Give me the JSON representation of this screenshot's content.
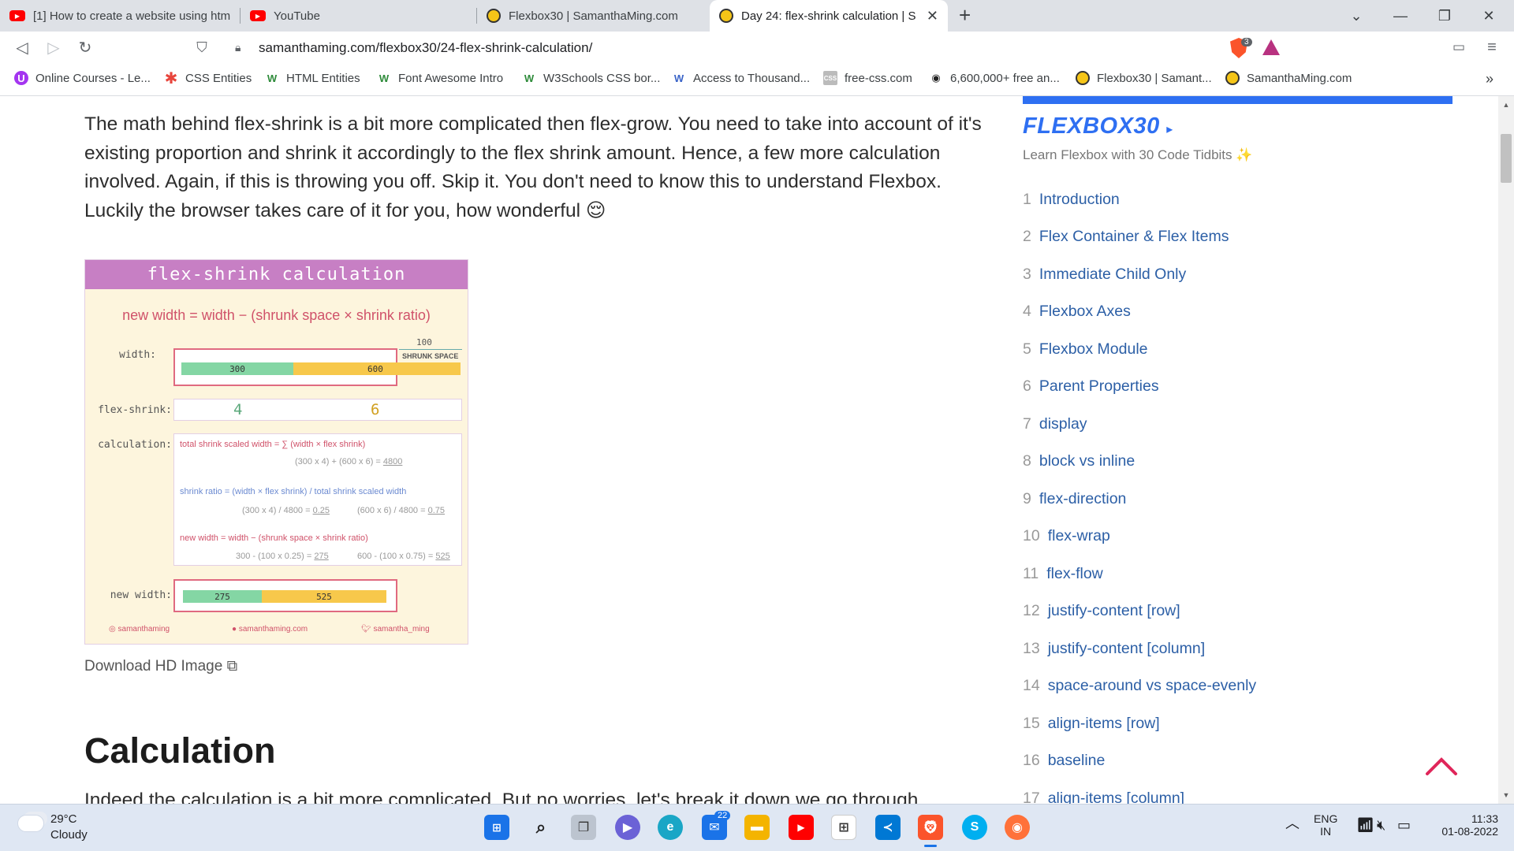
{
  "browser": {
    "tabs": [
      {
        "title": "[1] How to create a website using htm",
        "icon": "youtube-icon"
      },
      {
        "title": "YouTube",
        "icon": "youtube-icon"
      },
      {
        "title": "Flexbox30 | SamanthaMing.com",
        "icon": "samantha-icon"
      },
      {
        "title": "Day 24: flex-shrink calculation | S",
        "icon": "samantha-icon",
        "active": true
      }
    ],
    "url": "samanthaming.com/flexbox30/24-flex-shrink-calculation/",
    "shield_count": "3",
    "bookmarks": [
      {
        "label": "Online Courses - Le...",
        "icon": "udemy-icon"
      },
      {
        "label": "CSS Entities",
        "icon": "asterisk-icon"
      },
      {
        "label": "HTML Entities",
        "icon": "w-icon"
      },
      {
        "label": "Font Awesome Intro",
        "icon": "w3-icon"
      },
      {
        "label": "W3Schools CSS bor...",
        "icon": "w3-icon"
      },
      {
        "label": "Access to Thousand...",
        "icon": "w-icon"
      },
      {
        "label": "free-css.com",
        "icon": "css-icon"
      },
      {
        "label": "6,600,000+ free an...",
        "icon": "eye-icon"
      },
      {
        "label": "Flexbox30 | Samant...",
        "icon": "samantha-icon"
      },
      {
        "label": "SamanthaMing.com",
        "icon": "samantha-icon"
      }
    ]
  },
  "content": {
    "paragraph": "The math behind flex-shrink is a bit more complicated then flex-grow. You need to take into account of it's existing proportion and shrink it accordingly to the flex shrink amount. Hence, a few more calculation involved. Again, if this is throwing you off. Skip it. You don't need to know this to understand Flexbox. Luckily the browser takes care of it for you, how wonderful 😌",
    "infographic": {
      "title": "flex-shrink calculation",
      "formula": "new width  =  width  −  (shrunk space  ×  shrink ratio)",
      "width_label": "width:",
      "shrunk_value": "100",
      "shrunk_label": "SHRUNK SPACE",
      "bar_a": "300",
      "bar_b": "600",
      "flex_shrink_label": "flex-shrink:",
      "fs_a": "4",
      "fs_b": "6",
      "calc_label": "calculation:",
      "calc_line1": "total shrink scaled width  =  ∑ (width  ×  flex shrink)",
      "calc_line2": "(300 x 4) + (600 x 6) = ",
      "calc_line2_result": "4800",
      "calc_line3": "shrink ratio  =  (width  ×  flex shrink)  /  total shrink scaled width",
      "calc_line4a": "(300 x 4) / 4800 = ",
      "calc_line4a_result": "0.25",
      "calc_line4b": "(600 x 6) / 4800 = ",
      "calc_line4b_result": "0.75",
      "calc_line5": "new width  =  width  −  (shrunk space  ×  shrink ratio)",
      "calc_line6a": "300 - (100 x 0.25) = ",
      "calc_line6a_result": "275",
      "calc_line6b": "600 - (100 x 0.75) = ",
      "calc_line6b_result": "525",
      "new_width_label": "new width:",
      "new_a": "275",
      "new_b": "525",
      "footer_instagram": "samanthaming",
      "footer_site": "samanthaming.com",
      "footer_twitter": "samantha_ming"
    },
    "download_link": "Download HD Image",
    "heading": "Calculation",
    "paragraph2": "Indeed the calculation is a bit more complicated. But no worries, let's break it down we go through"
  },
  "sidebar": {
    "title": "FLEXBOX30",
    "subtitle": "Learn Flexbox with 30 Code Tidbits ✨",
    "items": [
      {
        "num": "1",
        "label": "Introduction"
      },
      {
        "num": "2",
        "label": "Flex Container & Flex Items"
      },
      {
        "num": "3",
        "label": "Immediate Child Only"
      },
      {
        "num": "4",
        "label": "Flexbox Axes"
      },
      {
        "num": "5",
        "label": "Flexbox Module"
      },
      {
        "num": "6",
        "label": "Parent Properties"
      },
      {
        "num": "7",
        "label": "display"
      },
      {
        "num": "8",
        "label": "block vs inline"
      },
      {
        "num": "9",
        "label": "flex-direction"
      },
      {
        "num": "10",
        "label": "flex-wrap"
      },
      {
        "num": "11",
        "label": "flex-flow"
      },
      {
        "num": "12",
        "label": "justify-content [row]"
      },
      {
        "num": "13",
        "label": "justify-content [column]"
      },
      {
        "num": "14",
        "label": "space-around vs space-evenly"
      },
      {
        "num": "15",
        "label": "align-items [row]"
      },
      {
        "num": "16",
        "label": "baseline"
      },
      {
        "num": "17",
        "label": "align-items [column]"
      }
    ]
  },
  "taskbar": {
    "temperature": "29°C",
    "weather": "Cloudy",
    "mail_badge": "22",
    "lang_top": "ENG",
    "lang_bottom": "IN",
    "time": "11:33",
    "date": "01-08-2022"
  },
  "colors": {
    "accent": "#2e6ff2",
    "infographic_header": "#c77fc4",
    "bar_green": "#84d6a4",
    "bar_yellow": "#f7c84b"
  }
}
